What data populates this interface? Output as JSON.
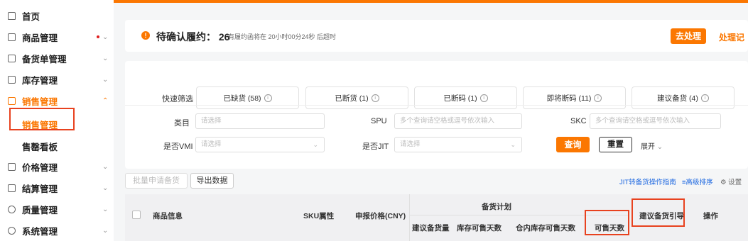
{
  "sidebar": {
    "items": [
      {
        "label": "首页",
        "icon": "home-icon"
      },
      {
        "label": "商品管理",
        "icon": "box-icon",
        "has_badge": true
      },
      {
        "label": "备货单管理",
        "icon": "document-icon"
      },
      {
        "label": "库存管理",
        "icon": "warehouse-icon"
      },
      {
        "label": "销售管理",
        "icon": "chart-icon",
        "expanded": true
      },
      {
        "label": "价格管理",
        "icon": "price-icon"
      },
      {
        "label": "结算管理",
        "icon": "wallet-icon"
      },
      {
        "label": "质量管理",
        "icon": "shield-icon"
      },
      {
        "label": "系统管理",
        "icon": "gear-icon"
      }
    ],
    "sub_items": [
      {
        "label": "销售管理",
        "active": true
      },
      {
        "label": "售罄看板"
      }
    ]
  },
  "notice": {
    "title": "待确认履约：",
    "count": "26",
    "subtitle": "有履约函将在 20小时00分24秒 后超时",
    "action_button": "去处理",
    "record_link": "处理记"
  },
  "quick_filter": {
    "label": "快速筛选",
    "chips": [
      "已缺货 (58)",
      "已断货 (1)",
      "已断码 (1)",
      "即将断码 (11)",
      "建议备货 (4)"
    ]
  },
  "filters": {
    "category_label": "类目",
    "category_placeholder": "请选择",
    "spu_label": "SPU",
    "spu_placeholder": "多个查询请空格或逗号依次输入",
    "skc_label": "SKC",
    "skc_placeholder": "多个查询请空格或逗号依次输入",
    "vmi_label": "是否VMI",
    "vmi_placeholder": "请选择",
    "jit_label": "是否JIT",
    "jit_placeholder": "请选择",
    "query_button": "查询",
    "reset_button": "重置",
    "expand_link": "展开"
  },
  "toolbar": {
    "batch_button": "批量申请备货",
    "export_button": "导出数据",
    "jit_guide_link": "JIT转备货操作指南",
    "advanced_sort_link": "高级排序",
    "settings_link": "设置"
  },
  "table": {
    "headers": {
      "product_info": "商品信息",
      "sku_attr": "SKU属性",
      "price": "申报价格(CNY)",
      "stock_plan": "备货计划",
      "suggest_qty": "建议备货量",
      "stock_days": "库存可售天数",
      "warehouse_days": "仓内库存可售天数",
      "sellable_days": "可售天数",
      "suggest_guide": "建议备货引导",
      "action": "操作"
    }
  },
  "colors": {
    "accent": "#fb7701",
    "highlight_box": "#e8421f",
    "link_blue": "#1a66e0"
  }
}
